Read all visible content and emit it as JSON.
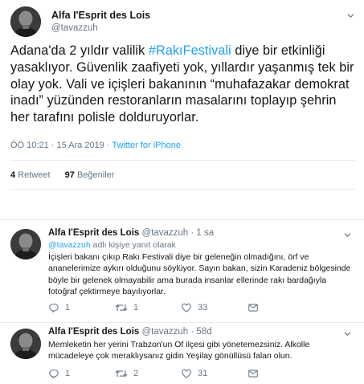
{
  "main_tweet": {
    "display_name": "Alfa I'Esprit des Lois",
    "handle": "@tavazzuh",
    "text_before": "Adana'da 2 yıldır valilik ",
    "hashtag": "#RakıFestivali",
    "text_after": " diye bir etkinliği yasaklıyor. Güvenlik zaafiyeti yok, yıllardır yaşanmış tek bir olay yok. Vali ve içişleri bakanının “muhafazakar demokrat inadı” yüzünden restoranların masalarını toplayıp şehrin her tarafını polisle dolduruyorlar.",
    "timestamp": "ÖÖ 10:21 · 15 Ara 2019 · ",
    "source": "Twitter for iPhone",
    "retweet_count": "4",
    "retweet_label": " Retweet",
    "like_count": "97",
    "like_label": " Beğeniler"
  },
  "replies": [
    {
      "display_name": "Alfa I'Esprit des Lois",
      "handle": "@tavazzuh",
      "time": "· 1 sa",
      "reply_to_handle": "@tavazzuh",
      "reply_to_suffix": " adlı kişiye yanıt olarak",
      "text": "İçişleri bakanı çıkıp Rakı Festivali diye bir geleneğin olmadığını, örf ve ananelerimize aykırı olduğunu söylüyor. Sayın bakan, sizin Karadeniz bölgesinde böyle bir gelenek olmayabilir ama burada insanlar ellerinde rakı bardağıyla fotoğraf çektirmeye bayılıyorlar.",
      "reply_count": "1",
      "retweet_count": "1",
      "like_count": "33"
    },
    {
      "display_name": "Alfa I'Esprit des Lois",
      "handle": "@tavazzuh",
      "time": "· 58d",
      "text": "Memleketin her yerini Trabzon'un Of ilçesi gibi yönetemezsiniz. Alkolle mücadeleye çok meraklıysanız gidin Yeşilay gönüllüsü falan olun.",
      "reply_count": "1",
      "retweet_count": "2",
      "like_count": "31"
    }
  ],
  "icons": {
    "menu": "chevron-down-icon",
    "reply": "reply-icon",
    "retweet": "retweet-icon",
    "like": "heart-icon",
    "dm": "envelope-icon"
  },
  "colors": {
    "accent": "#1da1f2",
    "secondary_text": "#657786",
    "primary_text": "#14171a",
    "divider": "#e6ecf0"
  }
}
